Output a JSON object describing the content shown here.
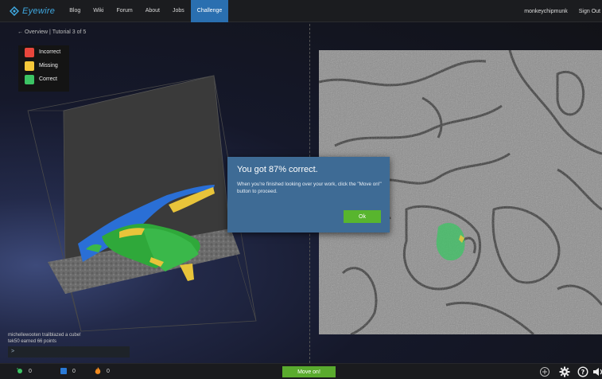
{
  "app": {
    "brand": "Eyewire",
    "brand_color": "#3fa8e0"
  },
  "nav": {
    "items": [
      {
        "label": "Blog"
      },
      {
        "label": "Wiki"
      },
      {
        "label": "Forum"
      },
      {
        "label": "About"
      },
      {
        "label": "Jobs"
      },
      {
        "label": "Challenge",
        "active": true
      }
    ],
    "active_color": "#2a6fb0"
  },
  "user": {
    "username": "monkeychipmunk",
    "sign_out": "Sign Out"
  },
  "breadcrumb": {
    "text": "← Overview | Tutorial 3 of 5"
  },
  "legend": {
    "items": [
      {
        "label": "Incorrect",
        "color": "#e8463c"
      },
      {
        "label": "Missing",
        "color": "#f5c83a"
      },
      {
        "label": "Correct",
        "color": "#3cc464"
      }
    ]
  },
  "chat": {
    "lines": [
      "michellewooten trailblazed a cube!",
      "tek50 earned 66 points"
    ],
    "input_prompt": ">"
  },
  "modal": {
    "title": "You got 87% correct.",
    "body": "When you're finished looking over your work, click the \"Move on!\" button to proceed.",
    "ok_label": "Ok"
  },
  "bottom": {
    "stats": [
      {
        "icon": "green-dot-icon",
        "value": "0"
      },
      {
        "icon": "blue-cube-icon",
        "value": "0"
      },
      {
        "icon": "flame-icon",
        "value": "0"
      }
    ],
    "move_on_label": "Move on!",
    "tools": [
      "add-icon",
      "settings-gear-icon",
      "help-icon",
      "sound-icon"
    ]
  }
}
